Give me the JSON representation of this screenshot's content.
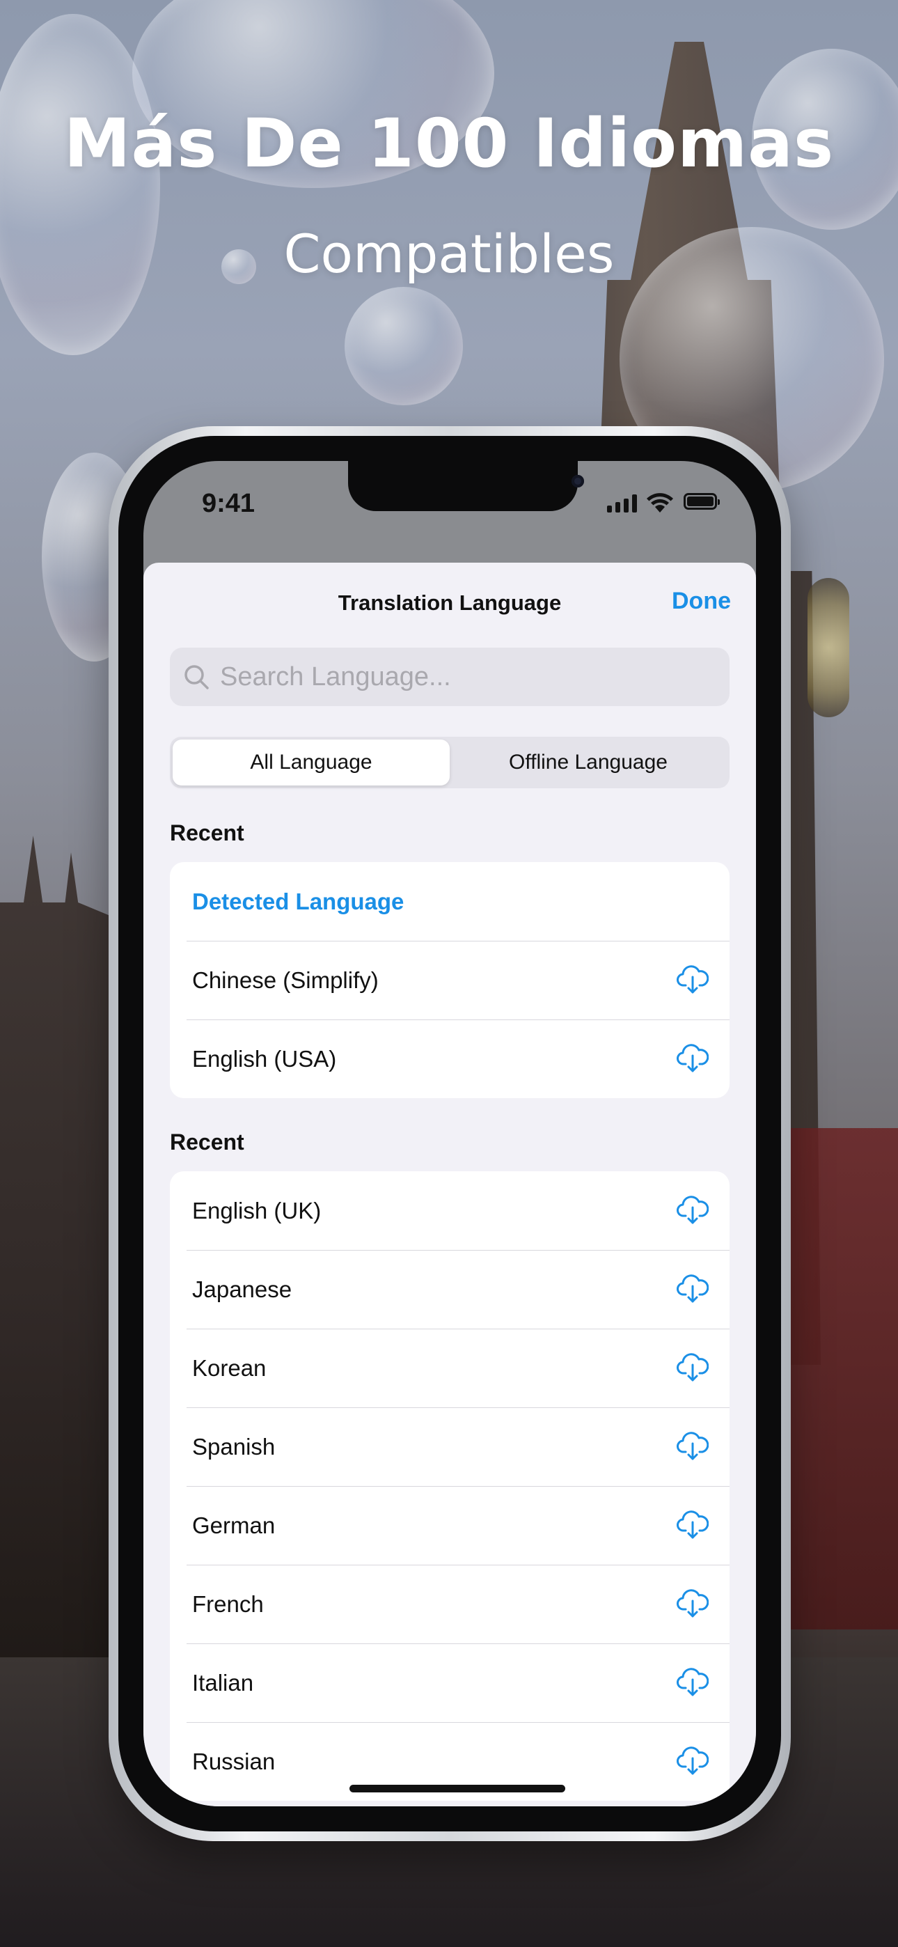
{
  "headline": {
    "line1": "Más De 100 Idiomas",
    "line2": "Compatibles"
  },
  "status_bar": {
    "time": "9:41"
  },
  "sheet": {
    "title": "Translation Language",
    "done_label": "Done",
    "search_placeholder": "Search Language...",
    "segments": [
      "All Language",
      "Offline Language"
    ],
    "selected_segment": "All Language"
  },
  "sections": [
    {
      "label": "Recent",
      "items": [
        {
          "label": "Detected Language",
          "highlight": true,
          "download_icon": false
        },
        {
          "label": "Chinese (Simplify)",
          "highlight": false,
          "download_icon": true
        },
        {
          "label": "English (USA)",
          "highlight": false,
          "download_icon": true
        }
      ]
    },
    {
      "label": "Recent",
      "items": [
        {
          "label": "English (UK)",
          "download_icon": true
        },
        {
          "label": "Japanese",
          "download_icon": true
        },
        {
          "label": "Korean",
          "download_icon": true
        },
        {
          "label": "Spanish",
          "download_icon": true
        },
        {
          "label": "German",
          "download_icon": true
        },
        {
          "label": "French",
          "download_icon": true
        },
        {
          "label": "Italian",
          "download_icon": true
        },
        {
          "label": "Russian",
          "download_icon": true
        }
      ]
    }
  ],
  "icons": {
    "search": "search-icon",
    "download": "cloud-download-icon"
  },
  "colors": {
    "accent": "#1a8fe6",
    "sheet_bg": "#f2f1f7"
  }
}
